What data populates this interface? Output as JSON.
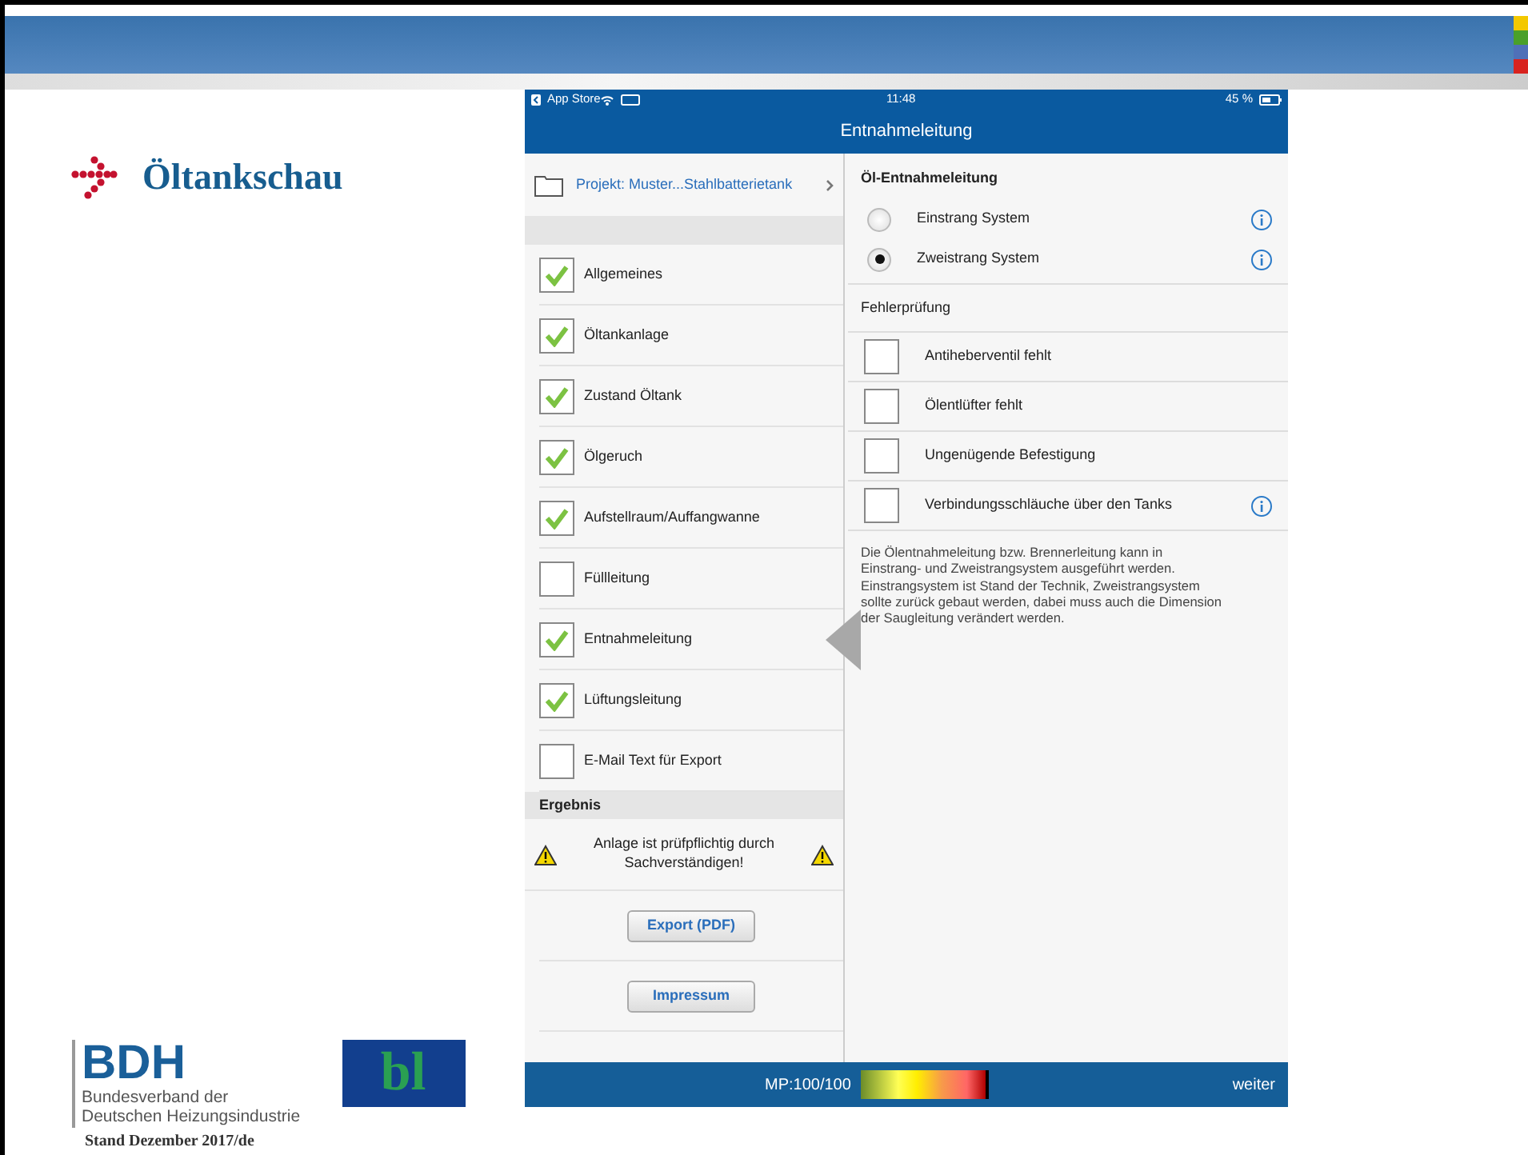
{
  "slide": {
    "brand": "Öltankschau",
    "bdh_abbr": "BDH",
    "bdh_name": [
      "Bundesverband der",
      "Deutschen Heizungsindustrie"
    ],
    "partner_logo": "bl",
    "footer": "Stand Dezember 2017/de"
  },
  "app": {
    "status_bar": {
      "back_app": "App Store",
      "time": "11:48",
      "battery": "45 %"
    },
    "nav_title": "Entnahmeleitung",
    "project": "Projekt: Muster...Stahlbatterietank",
    "checklist": [
      {
        "label": "Allgemeines",
        "checked": true,
        "selected": false
      },
      {
        "label": "Öltankanlage",
        "checked": true,
        "selected": false
      },
      {
        "label": "Zustand Öltank",
        "checked": true,
        "selected": false
      },
      {
        "label": "Ölgeruch",
        "checked": true,
        "selected": false
      },
      {
        "label": "Aufstellraum/Auffangwanne",
        "checked": true,
        "selected": false
      },
      {
        "label": "Füllleitung",
        "checked": false,
        "selected": false
      },
      {
        "label": "Entnahmeleitung",
        "checked": true,
        "selected": true
      },
      {
        "label": "Lüftungsleitung",
        "checked": true,
        "selected": false
      },
      {
        "label": "E-Mail Text für Export",
        "checked": false,
        "selected": false
      }
    ],
    "result": {
      "header": "Ergebnis",
      "warning": [
        "Anlage ist prüfpflichtig durch",
        "Sachverständigen!"
      ],
      "buttons": [
        "Export (PDF)",
        "Impressum"
      ]
    },
    "detail": {
      "title": "Öl-Entnahmeleitung",
      "options": [
        {
          "label": "Einstrang System",
          "selected": false,
          "info": true
        },
        {
          "label": "Zweistrang System",
          "selected": true,
          "info": true
        }
      ],
      "check_title": "Fehlerprüfung",
      "checks": [
        {
          "label": "Antiheberventil fehlt",
          "checked": false,
          "info": false
        },
        {
          "label": "Ölentlüfter fehlt",
          "checked": false,
          "info": false
        },
        {
          "label": "Ungenügende Befestigung",
          "checked": false,
          "info": false
        },
        {
          "label": "Verbindungsschläuche über den Tanks",
          "checked": false,
          "info": true
        }
      ],
      "description": "Die Ölentnahmeleitung bzw. Brennerleitung kann in Einstrang- und Zweistrangsystem ausgeführt werden. Einstrangsystem ist Stand der Technik, Zweistrangsystem sollte zurück gebaut werden, dabei muss auch die Dimension der Saugleitung verändert werden."
    },
    "bottom_bar": {
      "score": "MP:100/100",
      "level": 1.0,
      "next": "weiter"
    }
  }
}
